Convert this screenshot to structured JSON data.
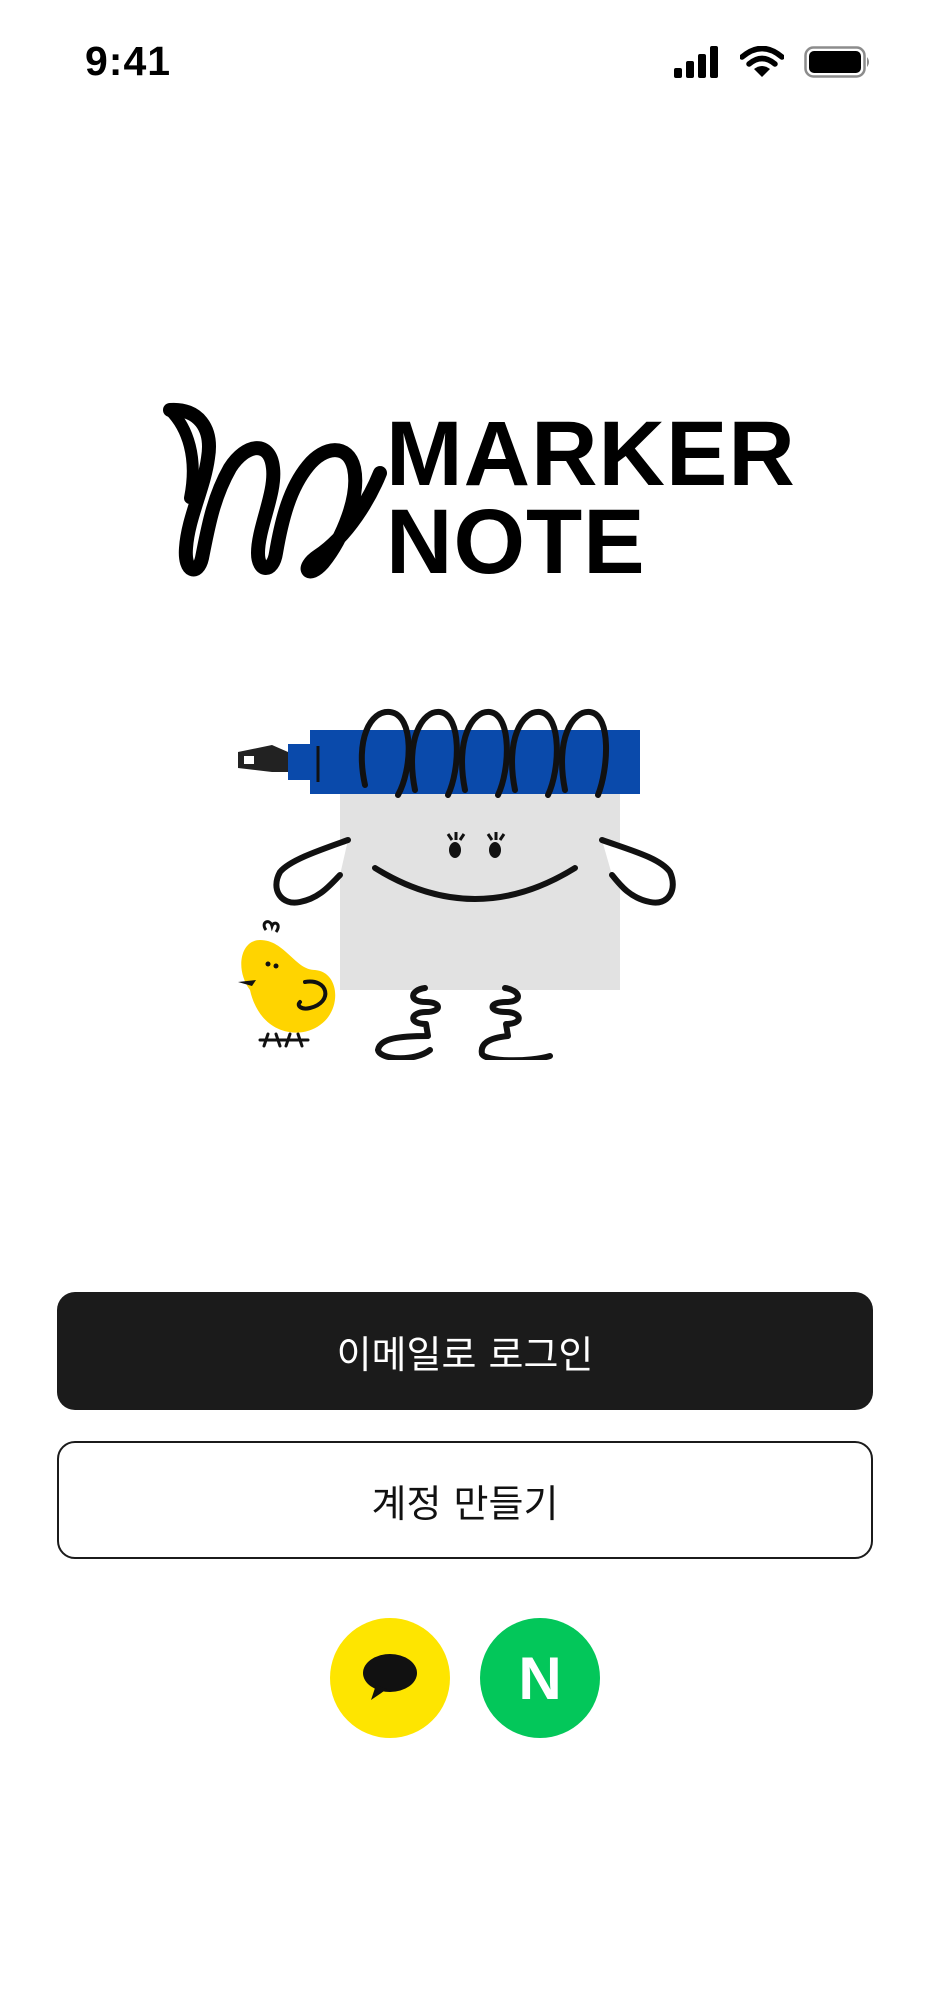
{
  "status_bar": {
    "time": "9:41",
    "icons": [
      "cellular-signal-icon",
      "wifi-icon",
      "battery-icon"
    ]
  },
  "logo": {
    "line1": "MARKER",
    "line2": "NOTE",
    "mark": "scribble-m-mark"
  },
  "illustration": {
    "name": "notepad-mascot-with-blue-marker-and-yellow-chick"
  },
  "buttons": {
    "email_login": "이메일로 로그인",
    "create_account": "계정 만들기"
  },
  "social_login": [
    {
      "provider": "kakao",
      "icon": "kakao-speech-bubble-icon",
      "color": "#FEE500"
    },
    {
      "provider": "naver",
      "icon": "naver-n-icon",
      "label": "N",
      "color": "#03C75A"
    }
  ],
  "colors": {
    "primary_button": "#1B1B1B",
    "marker_blue": "#0A4AAB",
    "chick_yellow": "#FFD400",
    "notepad_gray": "#E2E2E2"
  }
}
